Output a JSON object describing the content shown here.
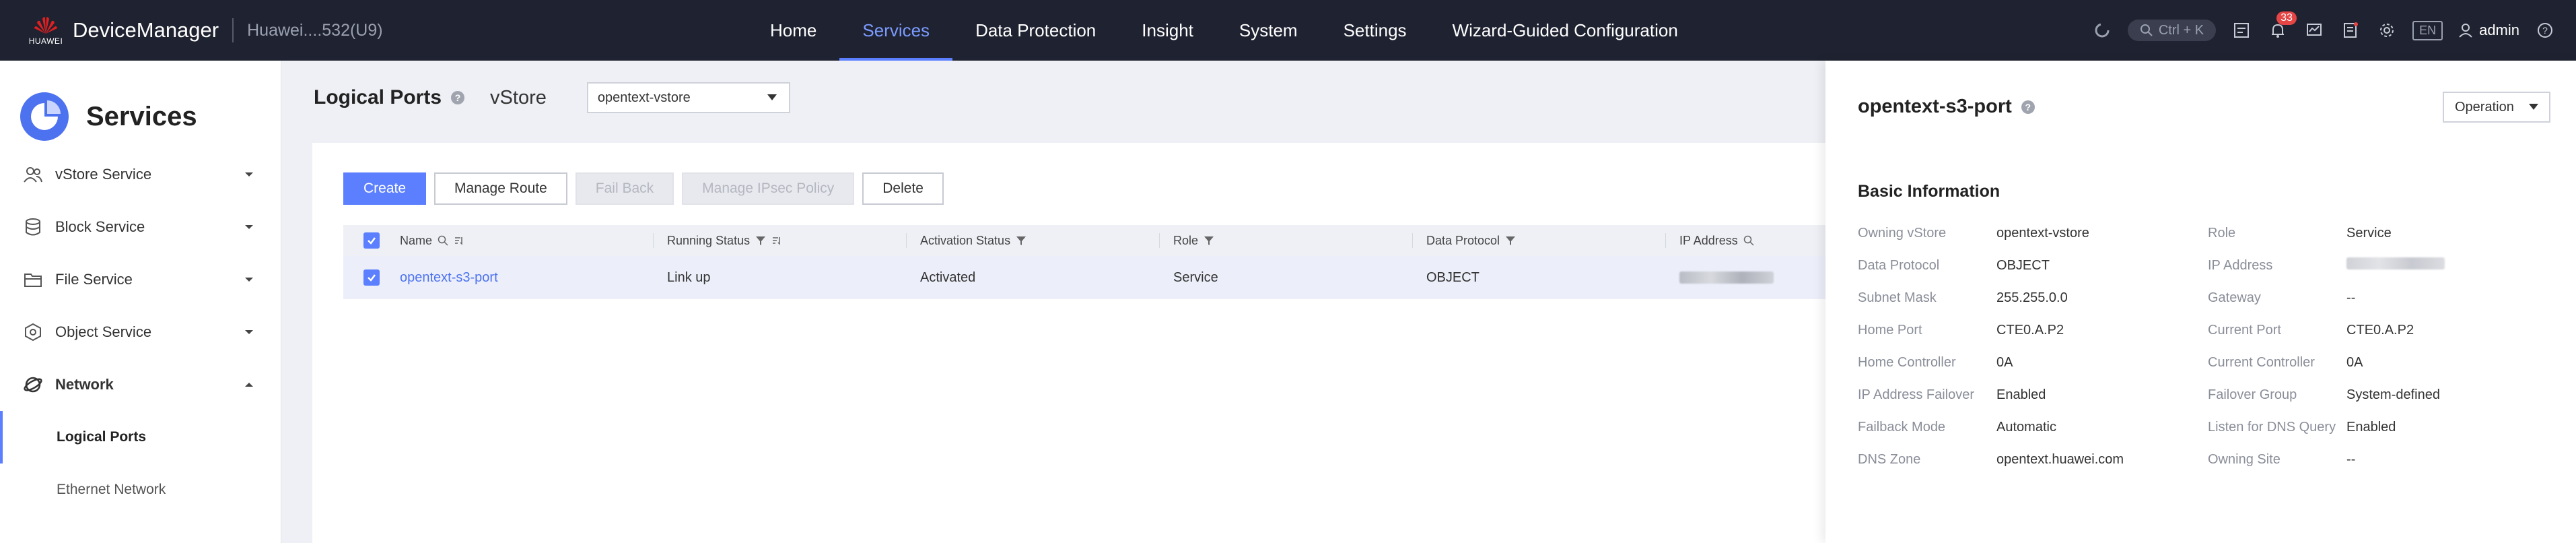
{
  "header": {
    "logo_text": "HUAWEI",
    "app_title": "DeviceManager",
    "device_name": "Huawei....532(U9)",
    "nav": [
      "Home",
      "Services",
      "Data Protection",
      "Insight",
      "System",
      "Settings",
      "Wizard-Guided Configuration"
    ],
    "active_nav": "Services",
    "search_shortcut": "Ctrl + K",
    "alarm_count": "33",
    "language": "EN",
    "user": "admin"
  },
  "sidebar": {
    "title": "Services",
    "items": [
      {
        "label": "vStore Service"
      },
      {
        "label": "Block Service"
      },
      {
        "label": "File Service"
      },
      {
        "label": "Object Service"
      },
      {
        "label": "Network"
      }
    ],
    "sub_items": [
      {
        "label": "Logical Ports"
      },
      {
        "label": "Ethernet Network"
      }
    ]
  },
  "main": {
    "title": "Logical Ports",
    "vstore_label": "vStore",
    "vstore_value": "opentext-vstore",
    "buttons": {
      "create": "Create",
      "manage_route": "Manage Route",
      "fail_back": "Fail Back",
      "manage_ipsec": "Manage IPsec Policy",
      "delete": "Delete"
    },
    "columns": [
      "Name",
      "Running Status",
      "Activation Status",
      "Role",
      "Data Protocol",
      "IP Address"
    ],
    "rows": [
      {
        "name": "opentext-s3-port",
        "running_status": "Link up",
        "activation_status": "Activated",
        "role": "Service",
        "data_protocol": "OBJECT"
      }
    ]
  },
  "detail": {
    "title": "opentext-s3-port",
    "operation": "Operation",
    "section": "Basic Information",
    "left": [
      {
        "label": "Owning vStore",
        "value": "opentext-vstore"
      },
      {
        "label": "Data Protocol",
        "value": "OBJECT"
      },
      {
        "label": "Subnet Mask",
        "value": "255.255.0.0"
      },
      {
        "label": "Home Port",
        "value": "CTE0.A.P2"
      },
      {
        "label": "Home Controller",
        "value": "0A"
      },
      {
        "label": "IP Address Failover",
        "value": "Enabled"
      },
      {
        "label": "Failback Mode",
        "value": "Automatic"
      },
      {
        "label": "DNS Zone",
        "value": "opentext.huawei.com"
      }
    ],
    "right": [
      {
        "label": "Role",
        "value": "Service"
      },
      {
        "label": "IP Address",
        "value": ""
      },
      {
        "label": "Gateway",
        "value": "--"
      },
      {
        "label": "Current Port",
        "value": "CTE0.A.P2"
      },
      {
        "label": "Current Controller",
        "value": "0A"
      },
      {
        "label": "Failover Group",
        "value": "System-defined"
      },
      {
        "label": "Listen for DNS Query",
        "value": "Enabled"
      },
      {
        "label": "Owning Site",
        "value": "--"
      }
    ]
  },
  "colors": {
    "accent": "#5b7fff",
    "topbar": "#1f2230",
    "alarm": "#e54545"
  }
}
